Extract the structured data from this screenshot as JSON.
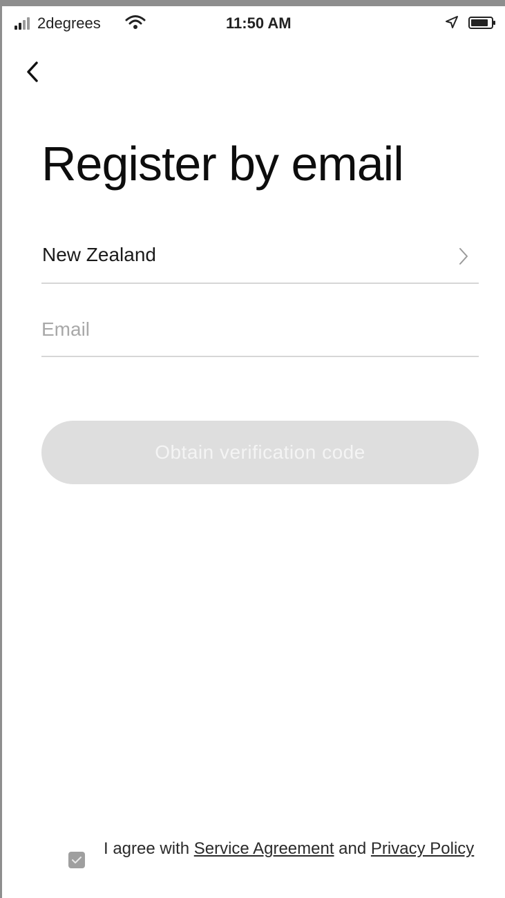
{
  "status_bar": {
    "carrier": "2degrees",
    "time": "11:50 AM"
  },
  "icons": {
    "back": "chevron-left-icon",
    "country_chevron": "chevron-right-icon",
    "signal": "cellular-signal-icon",
    "wifi": "wifi-icon",
    "location": "location-arrow-icon",
    "battery": "battery-icon",
    "checkbox": "checkbox-checked-icon"
  },
  "page": {
    "title": "Register by email"
  },
  "form": {
    "country": "New Zealand",
    "email_value": "",
    "email_placeholder": "Email",
    "submit_label": "Obtain verification code"
  },
  "agreement": {
    "checked": true,
    "text_before": "I agree with ",
    "service_link": "Service Agreement",
    "text_middle": " and ",
    "privacy_link": "Privacy Policy"
  },
  "colors": {
    "button_disabled_bg": "#dedede",
    "button_disabled_text": "#f4f4f4",
    "divider": "#d6d6d6",
    "checkbox": "#9f9f9f"
  }
}
